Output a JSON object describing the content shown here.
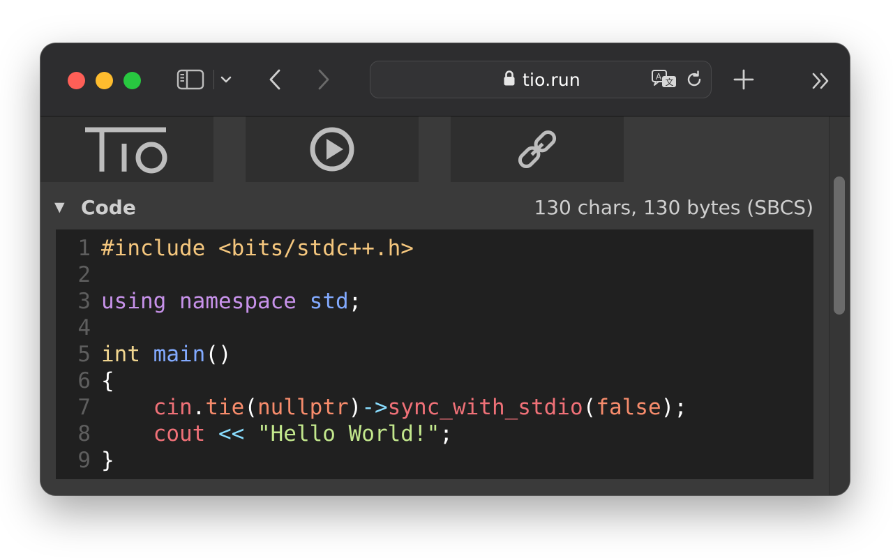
{
  "browser": {
    "url": "tio.run",
    "icons": {
      "sidebar": "sidebar-icon",
      "sidebar_menu": "chevron-down-icon",
      "back": "chevron-left-icon",
      "forward": "chevron-right-icon",
      "lock": "lock-icon",
      "translate": "translate-icon",
      "reload": "reload-icon",
      "new_tab": "plus-icon",
      "more": "double-chevron-right-icon"
    },
    "traffic_colors": {
      "close": "#fe5f57",
      "minimize": "#febc2e",
      "maximize": "#28c840"
    }
  },
  "tio": {
    "logo_text": "TIO",
    "run_icon": "play-circle-icon",
    "permalink_icon": "link-icon"
  },
  "code_section": {
    "caret": "▼",
    "title": "Code",
    "stats": "130 chars, 130 bytes (SBCS)"
  },
  "code_lines": [
    {
      "n": "1",
      "tokens": [
        {
          "t": "#include <bits/stdc++.h>",
          "c": "t-inc"
        }
      ]
    },
    {
      "n": "2",
      "tokens": []
    },
    {
      "n": "3",
      "tokens": [
        {
          "t": "using",
          "c": "t-kw"
        },
        {
          "t": " ",
          "c": "t-plain"
        },
        {
          "t": "namespace",
          "c": "t-kw"
        },
        {
          "t": " ",
          "c": "t-plain"
        },
        {
          "t": "std",
          "c": "t-ns"
        },
        {
          "t": ";",
          "c": "t-plain"
        }
      ]
    },
    {
      "n": "4",
      "tokens": []
    },
    {
      "n": "5",
      "tokens": [
        {
          "t": "int",
          "c": "t-type"
        },
        {
          "t": " ",
          "c": "t-plain"
        },
        {
          "t": "main",
          "c": "t-fn"
        },
        {
          "t": "()",
          "c": "t-plain"
        }
      ]
    },
    {
      "n": "6",
      "tokens": [
        {
          "t": "{",
          "c": "t-plain"
        }
      ]
    },
    {
      "n": "7",
      "tokens": [
        {
          "t": "    ",
          "c": "t-plain"
        },
        {
          "t": "cin",
          "c": "t-var"
        },
        {
          "t": ".",
          "c": "t-plain"
        },
        {
          "t": "tie",
          "c": "t-mth"
        },
        {
          "t": "(",
          "c": "t-plain"
        },
        {
          "t": "nullptr",
          "c": "t-lit"
        },
        {
          "t": ")",
          "c": "t-plain"
        },
        {
          "t": "->",
          "c": "t-op"
        },
        {
          "t": "sync_with_stdio",
          "c": "t-var"
        },
        {
          "t": "(",
          "c": "t-plain"
        },
        {
          "t": "false",
          "c": "t-lit"
        },
        {
          "t": ");",
          "c": "t-plain"
        }
      ]
    },
    {
      "n": "8",
      "tokens": [
        {
          "t": "    ",
          "c": "t-plain"
        },
        {
          "t": "cout",
          "c": "t-var"
        },
        {
          "t": " ",
          "c": "t-plain"
        },
        {
          "t": "<<",
          "c": "t-op"
        },
        {
          "t": " ",
          "c": "t-plain"
        },
        {
          "t": "\"Hello World!\"",
          "c": "t-str"
        },
        {
          "t": ";",
          "c": "t-plain"
        }
      ]
    },
    {
      "n": "9",
      "tokens": [
        {
          "t": "}",
          "c": "t-plain"
        }
      ]
    }
  ]
}
